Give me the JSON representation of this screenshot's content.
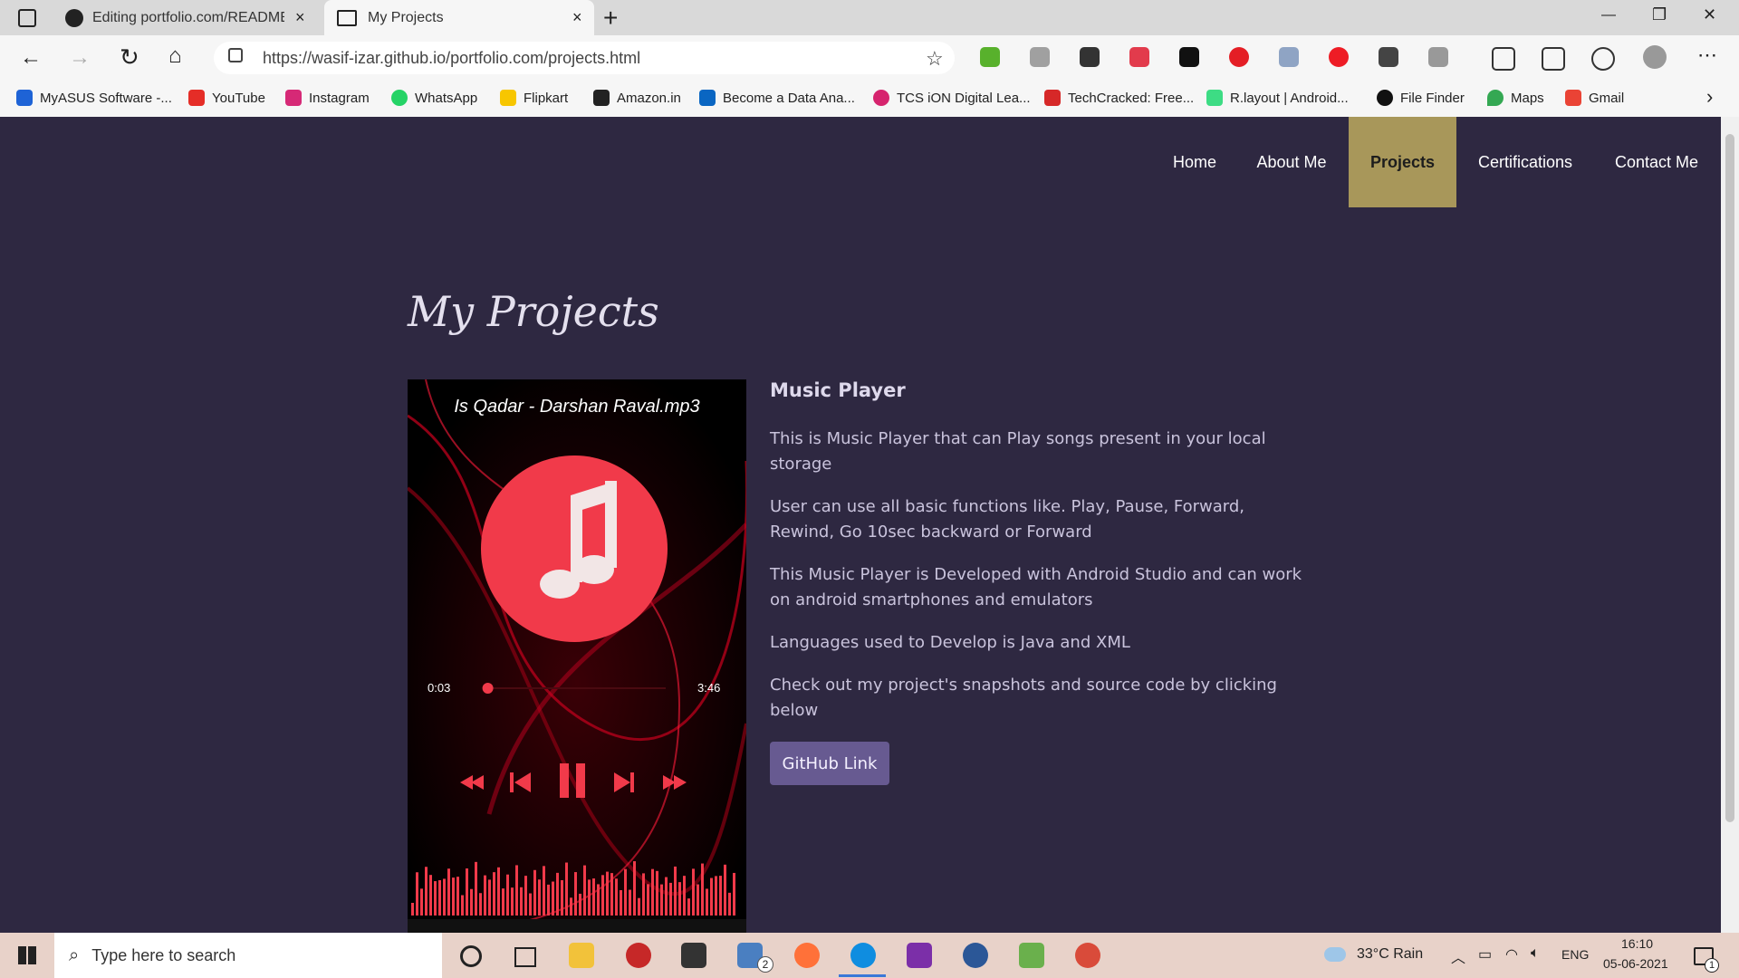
{
  "browser": {
    "tabs": [
      {
        "title": "Editing portfolio.com/README.m",
        "close": "×"
      },
      {
        "title": "My Projects",
        "close": "×"
      }
    ],
    "new_tab": "+",
    "window_controls": {
      "minimize": "—",
      "restore": "❐",
      "close": "✕"
    },
    "url": "https://wasif-izar.github.io/portfolio.com/projects.html",
    "bookmarks": [
      {
        "label": "MyASUS Software -...",
        "color": "#1e63d6"
      },
      {
        "label": "YouTube",
        "color": "#e52d27"
      },
      {
        "label": "Instagram",
        "color": "#d62976"
      },
      {
        "label": "WhatsApp",
        "color": "#25d366"
      },
      {
        "label": "Flipkart",
        "color": "#f7c600"
      },
      {
        "label": "Amazon.in",
        "color": "#222222"
      },
      {
        "label": "Become a Data Ana...",
        "color": "#0a66c2"
      },
      {
        "label": "TCS iON Digital Lea...",
        "color": "#d6246e"
      },
      {
        "label": "TechCracked: Free...",
        "color": "#d62828"
      },
      {
        "label": "R.layout  |  Android...",
        "color": "#3ddc84"
      },
      {
        "label": "File Finder",
        "color": "#111111"
      },
      {
        "label": "Maps",
        "color": "#34a853"
      },
      {
        "label": "Gmail",
        "color": "#ea4335"
      }
    ]
  },
  "nav": {
    "items": [
      {
        "label": "Home"
      },
      {
        "label": "About Me"
      },
      {
        "label": "Projects"
      },
      {
        "label": "Certifications"
      },
      {
        "label": "Contact Me"
      }
    ]
  },
  "main": {
    "heading": "My Projects",
    "project": {
      "title": "Music Player",
      "paragraphs": [
        "This is Music Player that can Play songs present in your local storage",
        "User can use all basic functions like. Play, Pause, Forward, Rewind, Go 10sec backward or Forward",
        "This Music Player is Developed with Android Studio and can work on android smartphones and emulators",
        "Languages used to Develop is Java and XML",
        "Check out my project's snapshots and source code by clicking below"
      ],
      "button": "GitHub Link"
    },
    "screenshot": {
      "song_title": "Is Qadar - Darshan Raval.mp3",
      "elapsed": "0:03",
      "duration": "3:46",
      "progress": 0.013,
      "accent": "#f13a4a"
    }
  },
  "taskbar": {
    "search_placeholder": "Type here to search",
    "weather": "33°C  Rain",
    "language": "ENG",
    "time": "16:10",
    "date": "05-06-2021",
    "mail_badge": "2",
    "notification_badge": "1"
  }
}
